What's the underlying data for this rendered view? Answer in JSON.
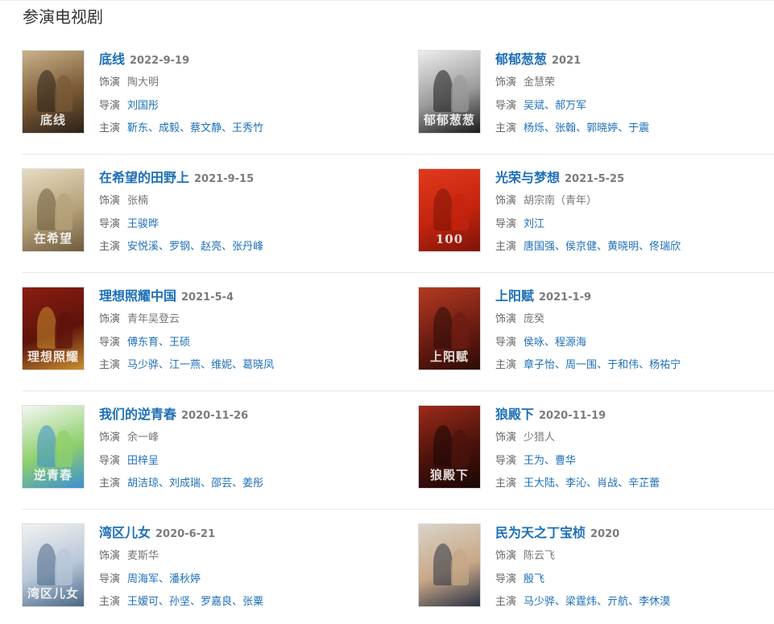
{
  "section": {
    "title": "参演电视剧"
  },
  "labels": {
    "role": "饰演",
    "director": "导演",
    "cast": "主演"
  },
  "works": [
    {
      "title": "底线",
      "date": "2022-9-19",
      "role": "陶大明",
      "directors": [
        "刘国彤"
      ],
      "cast": [
        "靳东",
        "成毅",
        "蔡文静",
        "王秀竹"
      ],
      "poster": {
        "glyph": "底线",
        "colors": [
          "#c9b28a",
          "#7a5a36",
          "#2b2118"
        ]
      }
    },
    {
      "title": "郁郁葱葱",
      "date": "2021",
      "role": "金慧荣",
      "directors": [
        "吴斌",
        "郝万军"
      ],
      "cast": [
        "杨烁",
        "张翰",
        "郭晓婷",
        "于震"
      ],
      "poster": {
        "glyph": "郁郁葱葱",
        "colors": [
          "#ededed",
          "#9a9a9a",
          "#1a1a1a"
        ]
      }
    },
    {
      "title": "在希望的田野上",
      "date": "2021-9-15",
      "role": "张楠",
      "directors": [
        "王骏晔"
      ],
      "cast": [
        "安悦溪",
        "罗钢",
        "赵亮",
        "张丹峰"
      ],
      "poster": {
        "glyph": "在希望",
        "colors": [
          "#e6dcc2",
          "#b7a27a",
          "#6d5b3e"
        ]
      }
    },
    {
      "title": "光荣与梦想",
      "date": "2021-5-25",
      "role": "胡宗南（青年）",
      "directors": [
        "刘江"
      ],
      "cast": [
        "唐国强",
        "侯京健",
        "黄晓明",
        "佟瑞欣"
      ],
      "poster": {
        "glyph": "100",
        "colors": [
          "#e03a1c",
          "#c4240f",
          "#7d1408"
        ]
      }
    },
    {
      "title": "理想照耀中国",
      "date": "2021-5-4",
      "role": "青年吴登云",
      "directors": [
        "傅东育",
        "王硕"
      ],
      "cast": [
        "马少骅",
        "江一燕",
        "维妮",
        "葛晓凤"
      ],
      "poster": {
        "glyph": "理想照耀",
        "colors": [
          "#8a1d12",
          "#5e130b",
          "#c8902e"
        ]
      }
    },
    {
      "title": "上阳赋",
      "date": "2021-1-9",
      "role": "庞癸",
      "directors": [
        "侯咏",
        "程源海"
      ],
      "cast": [
        "章子怡",
        "周一围",
        "于和伟",
        "杨祐宁"
      ],
      "poster": {
        "glyph": "上阳赋",
        "colors": [
          "#b33a22",
          "#6e1c12",
          "#2a0c08"
        ]
      }
    },
    {
      "title": "我们的逆青春",
      "date": "2020-11-26",
      "role": "余一峰",
      "directors": [
        "田梓呈"
      ],
      "cast": [
        "胡洁琼",
        "刘成瑞",
        "邵芸",
        "姜彤"
      ],
      "poster": {
        "glyph": "逆青春",
        "colors": [
          "#f4f7f2",
          "#8fd06c",
          "#3c8fd2"
        ]
      }
    },
    {
      "title": "狼殿下",
      "date": "2020-11-19",
      "role": "少猎人",
      "directors": [
        "王为",
        "曹华"
      ],
      "cast": [
        "王大陆",
        "李沁",
        "肖战",
        "辛芷蕾"
      ],
      "poster": {
        "glyph": "狼殿下",
        "colors": [
          "#9c2b1b",
          "#4b120b",
          "#1a0705"
        ]
      }
    },
    {
      "title": "湾区儿女",
      "date": "2020-6-21",
      "role": "麦斯华",
      "directors": [
        "周海军",
        "潘秋婷"
      ],
      "cast": [
        "王嫒可",
        "孙坚",
        "罗嘉良",
        "张粟"
      ],
      "poster": {
        "glyph": "湾区儿女",
        "colors": [
          "#f2f2f2",
          "#b8c7d8",
          "#4a6786"
        ]
      }
    },
    {
      "title": "民为天之丁宝桢",
      "date": "2020",
      "role": "陈云飞",
      "directors": [
        "殷飞"
      ],
      "cast": [
        "马少骅",
        "梁霆炜",
        "亓航",
        "李休漠"
      ],
      "poster": {
        "glyph": "",
        "colors": [
          "#d9d3c8",
          "#c8a887",
          "#2c3345"
        ]
      }
    }
  ]
}
